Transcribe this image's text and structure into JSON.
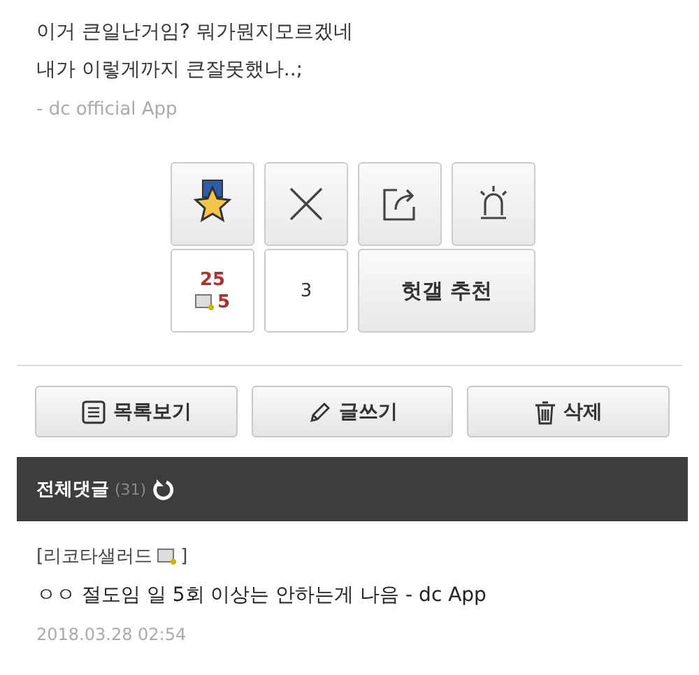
{
  "post": {
    "lines": [
      "이거 큰일난거임? 뭐가뭔지모르겠네",
      "내가 이렇게까지 큰잘못했나..;"
    ],
    "signature": "- dc official App"
  },
  "votes": {
    "recommend_count": "25",
    "fixed_count": "5",
    "downvote_count": "3",
    "hit_button": "헛갤 추천"
  },
  "actions": [
    {
      "kind": "list",
      "label": "목록보기"
    },
    {
      "kind": "write",
      "label": "글쓰기"
    },
    {
      "kind": "delete",
      "label": "삭제"
    }
  ],
  "comments_header": {
    "title": "전체댓글",
    "count": "(31)"
  },
  "comments": [
    {
      "author": "[리코타샐러드",
      "author_end": "]",
      "text": "ㅇㅇ 절도임 일 5회 이상는 안하는게 나음 - dc App",
      "date": "2018.03.28 02:54"
    }
  ]
}
